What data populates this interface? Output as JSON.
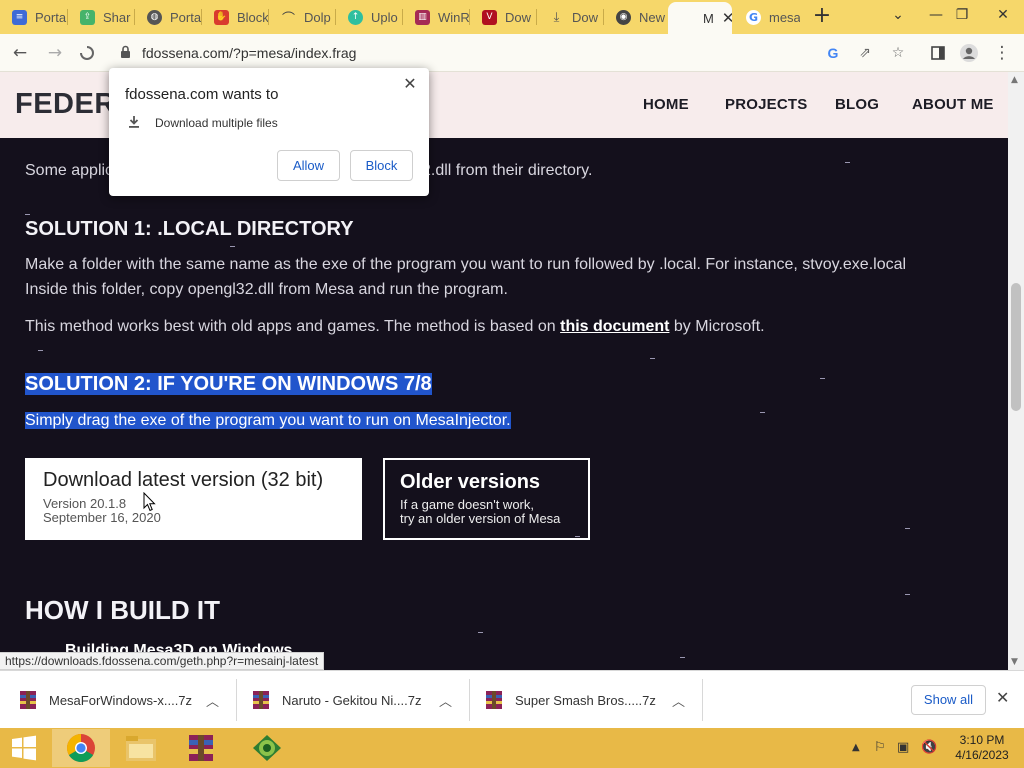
{
  "browser": {
    "tabs": [
      {
        "label": "Porta",
        "icon": "stack-icon",
        "color": "#3e6bd6"
      },
      {
        "label": "Shar",
        "icon": "share-icon",
        "color": "#46b36a"
      },
      {
        "label": "Porta",
        "icon": "globe-icon",
        "color": "#555555"
      },
      {
        "label": "Block",
        "icon": "shield-icon",
        "color": "#d93b2e"
      },
      {
        "label": "Dolp",
        "icon": "dolphin-icon",
        "color": "#444444"
      },
      {
        "label": "Uplo",
        "icon": "upload-icon",
        "color": "#2fbf9f"
      },
      {
        "label": "WinR",
        "icon": "winrar-icon",
        "color": "#a52a55"
      },
      {
        "label": "Dow",
        "icon": "download-site-icon",
        "color": "#b01020"
      },
      {
        "label": "Dow",
        "icon": "download-icon",
        "color": "#555555"
      },
      {
        "label": "New",
        "icon": "chrome-icon",
        "color": "#444444"
      },
      {
        "label": "M",
        "icon": "site-icon",
        "color": "#888888",
        "active": true
      },
      {
        "label": "mesa",
        "icon": "google-icon",
        "color": "#4285f4"
      }
    ],
    "new_tab": "+",
    "url": "fdossena.com/?p=mesa/index.frag"
  },
  "site": {
    "logo": "FEDER",
    "nav": [
      "HOME",
      "PROJECTS",
      "BLOG",
      "ABOUT ME"
    ]
  },
  "content": {
    "intro_left": "Some applic",
    "intro_right": "2.dll from their directory.",
    "solution1_heading": "SOLUTION 1: .LOCAL DIRECTORY",
    "solution1_line1": "Make a folder with the same name as the exe of the program you want to run followed by .local. For instance, stvoy.exe.local",
    "solution1_line2": "Inside this folder, copy opengl32.dll from Mesa and run the program.",
    "solution1_line3_pre": "This method works best with old apps and games. The method is based on ",
    "solution1_link": "this document",
    "solution1_line3_post": " by Microsoft.",
    "solution2_heading": "SOLUTION 2: IF YOU'RE ON WINDOWS 7/8",
    "solution2_text": "Simply drag the exe of the program you want to run on MesaInjector.",
    "latest_button": {
      "title": "Download latest version (32 bit)",
      "version": "Version 20.1.8",
      "date": "September 16, 2020"
    },
    "older_button": {
      "title": "Older versions",
      "line1": "If a game doesn't work,",
      "line2": "try an older version of Mesa"
    },
    "build_heading": "HOW I BUILD IT",
    "build_item": "Building Mesa3D on Windows"
  },
  "popup": {
    "title": "fdossena.com wants to",
    "permission": "Download multiple files",
    "allow": "Allow",
    "block": "Block"
  },
  "status_url": "https://downloads.fdossena.com/geth.php?r=mesainj-latest",
  "downloads": {
    "items": [
      "MesaForWindows-x....7z",
      "Naruto - Gekitou Ni....7z",
      "Super Smash Bros.....7z"
    ],
    "show_all": "Show all"
  },
  "taskbar": {
    "time": "3:10 PM",
    "date": "4/16/2023"
  },
  "colors": {
    "tabstrip": "#f6d76a",
    "page_bg": "#14101c",
    "highlight": "#2155cc",
    "taskbar": "#e8b947"
  }
}
